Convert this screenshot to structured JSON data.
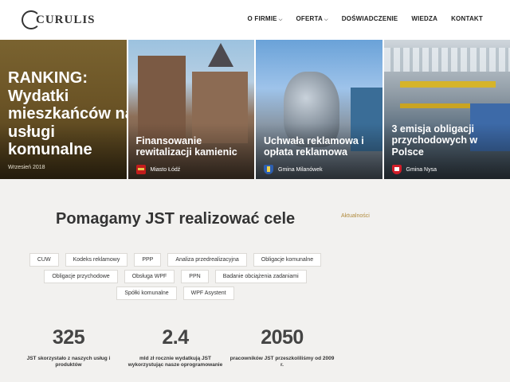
{
  "header": {
    "logo_text": "CURULIS",
    "nav": [
      {
        "label": "O FIRMIE",
        "has_dropdown": true
      },
      {
        "label": "OFERTA",
        "has_dropdown": true
      },
      {
        "label": "DOŚWIADCZENIE",
        "has_dropdown": false
      },
      {
        "label": "WIEDZA",
        "has_dropdown": false
      },
      {
        "label": "KONTAKT",
        "has_dropdown": false
      }
    ]
  },
  "tiles": [
    {
      "title": "RANKING: Wydatki mieszkańców na usługi komunalne",
      "meta": "Wrzesień 2018"
    },
    {
      "title": "Finansowanie rewitalizacji kamienic",
      "meta": "Miasto Łódź",
      "crest_icon": "lodz-crest-icon"
    },
    {
      "title": "Uchwała reklamowa i opłata reklamowa",
      "meta": "Gmina Milanówek",
      "crest_icon": "milanowek-crest-icon"
    },
    {
      "title": "3 emisja obligacji przychodowych w Polsce",
      "meta": "Gmina Nysa",
      "crest_icon": "nysa-crest-icon"
    }
  ],
  "main": {
    "headline": "Pomagamy JST realizować cele",
    "news_link": "Aktualności",
    "tags": [
      "CUW",
      "Kodeks reklamowy",
      "PPP",
      "Analiza przedrealizacyjna",
      "Obligacje komunalne",
      "Obligacje przychodowe",
      "Obsługa WPF",
      "PPN",
      "Badanie obciążenia zadaniami",
      "Spółki komunalne",
      "WPF Asystent"
    ],
    "stats": [
      {
        "value": "325",
        "label": "JST skorzystało z naszych usług i produktów"
      },
      {
        "value": "2.4",
        "label": "mld zł rocznie wydatkują JST wykorzystując nasze oprogramowanie"
      },
      {
        "value": "2050",
        "label": "pracowników JST przeszkoliliśmy od 2009 r."
      }
    ]
  },
  "colors": {
    "accent": "#b08a3c",
    "background": "#f2f1ef",
    "header_bg": "#ffffff"
  }
}
